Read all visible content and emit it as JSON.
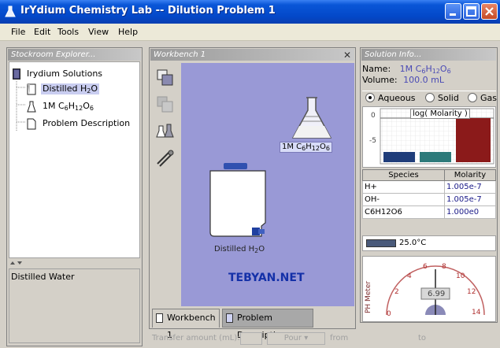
{
  "window": {
    "title": "IrYdium Chemistry Lab -- Dilution Problem 1"
  },
  "menu": {
    "items": [
      {
        "label": "File"
      },
      {
        "label": "Edit"
      },
      {
        "label": "Tools"
      },
      {
        "label": "View"
      },
      {
        "label": "Help"
      }
    ]
  },
  "stockroom": {
    "header": "Stockroom Explorer...",
    "root": "Irydium Solutions",
    "items": [
      {
        "label": "Distilled H",
        "sub": "2",
        "tail": "O",
        "selected": true,
        "icon": "beaker-icon"
      },
      {
        "label": "1M C",
        "sub": "6",
        "mid": "H",
        "sub2": "12",
        "mid2": "O",
        "sub3": "6",
        "icon": "flask-icon"
      },
      {
        "label": "Problem Description",
        "icon": "document-icon"
      }
    ],
    "description": "Distilled Water"
  },
  "workbench": {
    "header": "Workbench 1",
    "flask_label_prefix": "1M C",
    "flask_sub1": "6",
    "flask_mid1": "H",
    "flask_sub2": "12",
    "flask_mid2": "O",
    "flask_sub3": "6",
    "carboy_label_prefix": "Distilled H",
    "carboy_sub": "2",
    "carboy_tail": "O",
    "watermark": "TEBYAN.NET",
    "tabs": [
      {
        "label": "Workbench 1",
        "active": true
      },
      {
        "label": "Problem Description",
        "active": false
      }
    ]
  },
  "solution_info": {
    "header": "Solution Info...",
    "name_label": "Name:",
    "name_prefix": "1M C",
    "name_sub1": "6",
    "name_mid1": "H",
    "name_sub2": "12",
    "name_mid2": "O",
    "name_sub3": "6",
    "volume_label": "Volume:",
    "volume_value": "100.0 mL",
    "phases": [
      {
        "label": "Aqueous",
        "selected": true
      },
      {
        "label": "Solid",
        "selected": false
      },
      {
        "label": "Gas",
        "selected": false
      }
    ],
    "chart_title": "log( Molarity )",
    "chart_tick_top": "0",
    "chart_tick_mid": "-5",
    "bar_colors": [
      "#1f3d7a",
      "#2d7a7a",
      "#8b1a1a"
    ],
    "table": {
      "headers": [
        "Species",
        "Molarity"
      ],
      "rows": [
        {
          "species": "H+",
          "molarity": "1.005e-7"
        },
        {
          "species": "OH-",
          "molarity": "1.005e-7"
        },
        {
          "species": "C6H12O6",
          "molarity": "1.000e0"
        }
      ]
    },
    "temperature": "25.0°C",
    "ph_label": "PH Meter",
    "ph_reading": "6.99",
    "ph_ticks": [
      "0",
      "2",
      "4",
      "6",
      "8",
      "10",
      "12",
      "14"
    ]
  },
  "transfer": {
    "label": "Transfer amount (mL):",
    "pour": "Pour",
    "from": "from",
    "to": "to"
  }
}
